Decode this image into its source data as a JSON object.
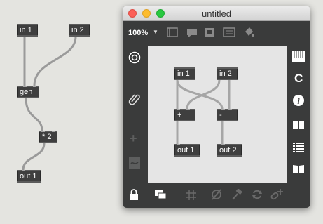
{
  "patch": {
    "objects": {
      "in1": "in 1",
      "in2": "in 2",
      "gen": "gen",
      "mul": "* 2",
      "out1": "out 1"
    }
  },
  "window": {
    "title": "untitled",
    "zoom": "100%",
    "objects": {
      "in1": "in 1",
      "in2": "in 2",
      "plus": "+",
      "minus": "-",
      "out1": "out 1",
      "out2": "out 2"
    },
    "sidebar_right": {
      "c_label": "C",
      "info_label": "i"
    }
  },
  "colors": {
    "background": "#e4e4e0",
    "object_fill": "#3f3f3f",
    "window_frame": "#3a3b3b",
    "canvas": "#e5e5e5",
    "close": "#fc5f57",
    "minimize": "#fdbc2e",
    "zoom": "#28c840"
  }
}
